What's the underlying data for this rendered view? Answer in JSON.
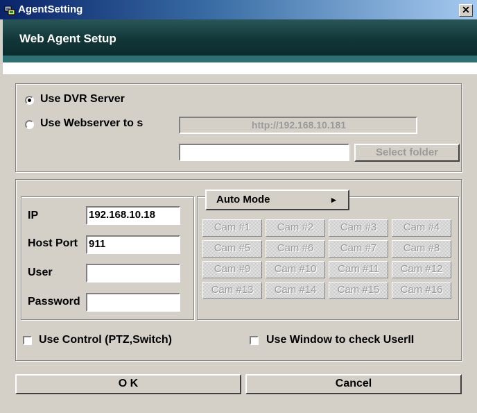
{
  "window": {
    "title": "AgentSetting",
    "close_glyph": "✕",
    "icon": "app-icon"
  },
  "header": {
    "title": "Web Agent Setup"
  },
  "server_group": {
    "use_dvr_label": "Use DVR Server",
    "use_webserver_label": "Use Webserver to s",
    "url_value": "http://192.168.10.181",
    "folder_value": "",
    "select_folder_label": "Select folder",
    "selected": "use_dvr"
  },
  "login": {
    "ip_label": "IP",
    "ip_value": "192.168.10.18",
    "port_label": "Host Port",
    "port_value": "911",
    "user_label": "User",
    "user_value": "",
    "password_label": "Password",
    "password_value": ""
  },
  "cams": {
    "mode_label": "Auto Mode",
    "mode_arrow": "▸",
    "buttons": [
      "Cam #1",
      "Cam #2",
      "Cam #3",
      "Cam #4",
      "Cam #5",
      "Cam #6",
      "Cam #7",
      "Cam #8",
      "Cam #9",
      "Cam #10",
      "Cam #11",
      "Cam #12",
      "Cam #13",
      "Cam #14",
      "Cam #15",
      "Cam #16"
    ]
  },
  "options": {
    "use_control_label": "Use Control (PTZ,Switch)",
    "use_control_checked": false,
    "use_window_label": "Use Window to check UserII",
    "use_window_checked": false
  },
  "footer": {
    "ok_label": "O K",
    "cancel_label": "Cancel"
  }
}
